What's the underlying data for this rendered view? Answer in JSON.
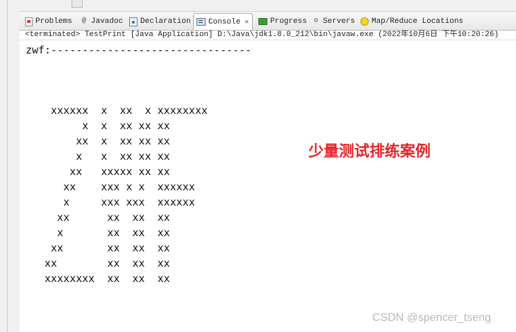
{
  "tabs": [
    {
      "label": "Problems",
      "icon": "problems-icon"
    },
    {
      "label": "Javadoc",
      "icon": "javadoc-icon"
    },
    {
      "label": "Declaration",
      "icon": "declaration-icon"
    },
    {
      "label": "Console",
      "icon": "console-icon",
      "active": true
    },
    {
      "label": "Progress",
      "icon": "progress-icon"
    },
    {
      "label": "Servers",
      "icon": "servers-icon"
    },
    {
      "label": "Map/Reduce Locations",
      "icon": "mapreduce-icon"
    }
  ],
  "console": {
    "status": "<terminated> TestPrint [Java Application] D:\\Java\\jdk1.8.0_212\\bin\\javaw.exe (2022年10月6日 下午10:20:26)",
    "first_line": "zwf:--------------------------------",
    "lines": [
      "    xxxxxx  x  xx  x xxxxxxxx",
      "         x  x  xx xx xx",
      "        xx  x  xx xx xx",
      "        x   x  xx xx xx",
      "       xx   xxxxx xx xx",
      "      xx    xxx x x  xxxxxx",
      "      x     xxx xxx  xxxxxx",
      "     xx      xx  xx  xx",
      "     x       xx  xx  xx",
      "    xx       xx  xx  xx",
      "   xx        xx  xx  xx",
      "   xxxxxxxx  xx  xx  xx"
    ]
  },
  "annotation": "少量测试排练案例",
  "watermark": "CSDN @spencer_tseng",
  "colors": {
    "annotation": "#e3262a",
    "watermark": "#b8b8b8"
  }
}
